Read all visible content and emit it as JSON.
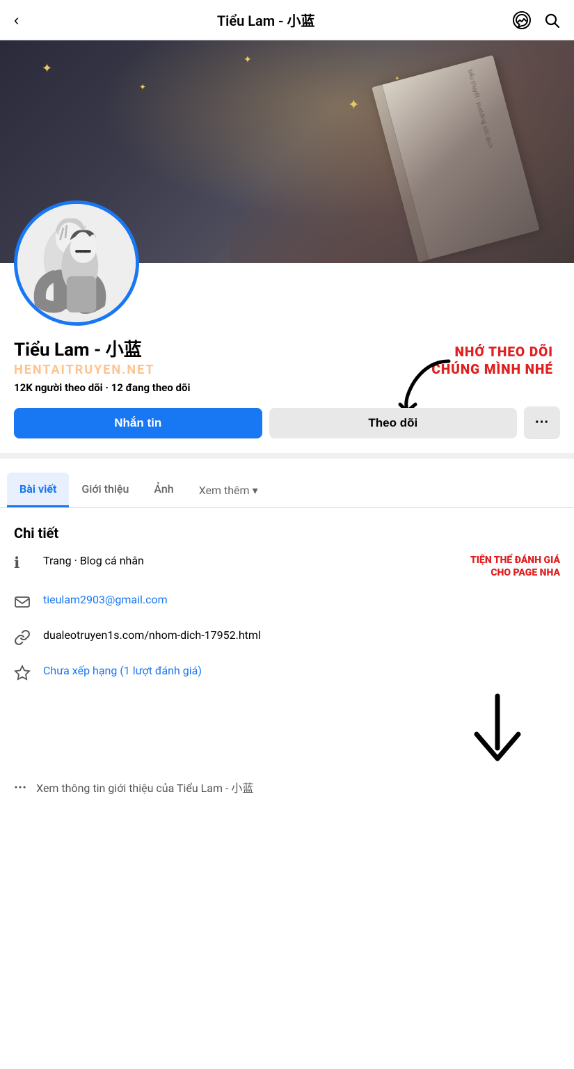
{
  "topbar": {
    "title": "Tiểu Lam - 小蓝",
    "back_label": "‹",
    "messenger_icon": "messenger",
    "search_icon": "search"
  },
  "cover": {
    "sparkles": [
      "✦",
      "✦",
      "✦",
      "✦",
      "✦"
    ],
    "book_text": "tiểu thuyết · pudding sốc dịch"
  },
  "profile": {
    "name": "Tiểu Lam - 小蓝",
    "watermark": "HENTAITRUYEN.NET",
    "followers_count": "12K",
    "followers_label": "người theo dõi",
    "following_count": "12",
    "following_label": "đang theo dõi",
    "annotation_text": "NHỚ THEO DÕI\nCHÚNG MÌNH NHÉ"
  },
  "actions": {
    "message_label": "Nhắn tin",
    "follow_label": "Theo dõi",
    "more_label": "···"
  },
  "tabs": [
    {
      "label": "Bài viết",
      "active": true
    },
    {
      "label": "Giới thiệu",
      "active": false
    },
    {
      "label": "Ảnh",
      "active": false
    },
    {
      "label": "Xem thêm ▾",
      "active": false
    }
  ],
  "details": {
    "title": "Chi tiết",
    "items": [
      {
        "icon": "ℹ",
        "text": "Trang · Blog cá nhân",
        "annotation": "TIỆN THỂ ĐÁNH GIÁ\nCHO PAGE NHA"
      },
      {
        "icon": "✉",
        "text": "tieulam2903@gmail.com",
        "is_link": false
      },
      {
        "icon": "🔗",
        "text": "dualeotruyen1s.com/nhom-dich-17952.html",
        "is_link": false
      },
      {
        "icon": "⭐",
        "text": "Chưa xếp hạng (1 lượt đánh giá)",
        "is_link": true
      }
    ]
  },
  "see_more": {
    "dots": "···",
    "text": "Xem thông tin giới thiệu của Tiểu Lam - 小蓝"
  }
}
